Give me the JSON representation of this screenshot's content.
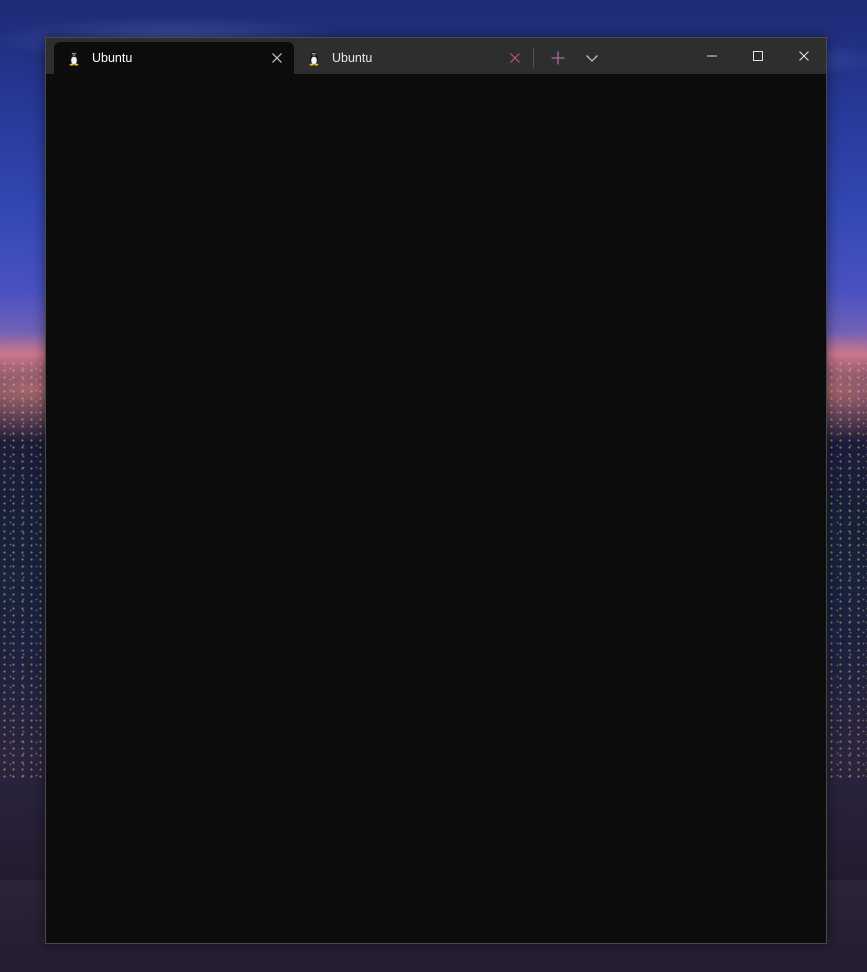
{
  "tabs": [
    {
      "title": "Ubuntu",
      "icon": "linux-penguin-icon",
      "active": true
    },
    {
      "title": "Ubuntu",
      "icon": "linux-penguin-icon",
      "active": false
    }
  ],
  "toolbar": {
    "new_tab_icon": "plus-icon",
    "dropdown_icon": "chevron-down-icon"
  },
  "window_controls": {
    "minimize_icon": "minimize-icon",
    "maximize_icon": "maximize-icon",
    "close_icon": "close-icon"
  },
  "colors": {
    "titlebar": "#2e2e2e",
    "active_tab": "#0c0c0c",
    "terminal_background": "#0c0c0c",
    "inactive_close_accent": "#c24d8a",
    "new_tab_accent": "#b06aa0"
  },
  "terminal": {
    "content": ""
  }
}
